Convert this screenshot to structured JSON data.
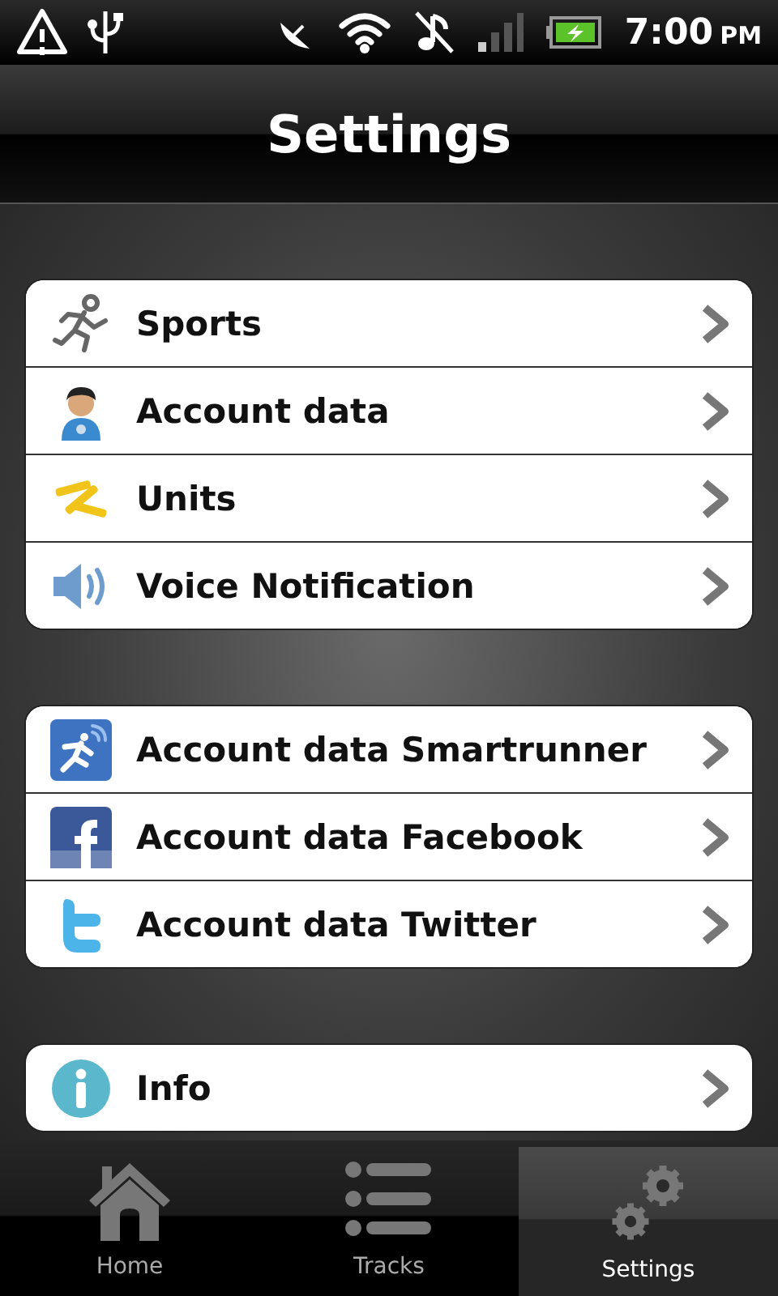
{
  "status_bar": {
    "time": "7:00",
    "ampm": "PM"
  },
  "title": "Settings",
  "groups": [
    {
      "items": [
        {
          "label": "Sports"
        },
        {
          "label": "Account data"
        },
        {
          "label": "Units"
        },
        {
          "label": "Voice Notification"
        }
      ]
    },
    {
      "items": [
        {
          "label": "Account data Smartrunner"
        },
        {
          "label": "Account data Facebook"
        },
        {
          "label": "Account data Twitter"
        }
      ]
    },
    {
      "items": [
        {
          "label": "Info"
        }
      ]
    }
  ],
  "tabs": [
    {
      "label": "Home",
      "selected": false
    },
    {
      "label": "Tracks",
      "selected": false
    },
    {
      "label": "Settings",
      "selected": true
    }
  ]
}
